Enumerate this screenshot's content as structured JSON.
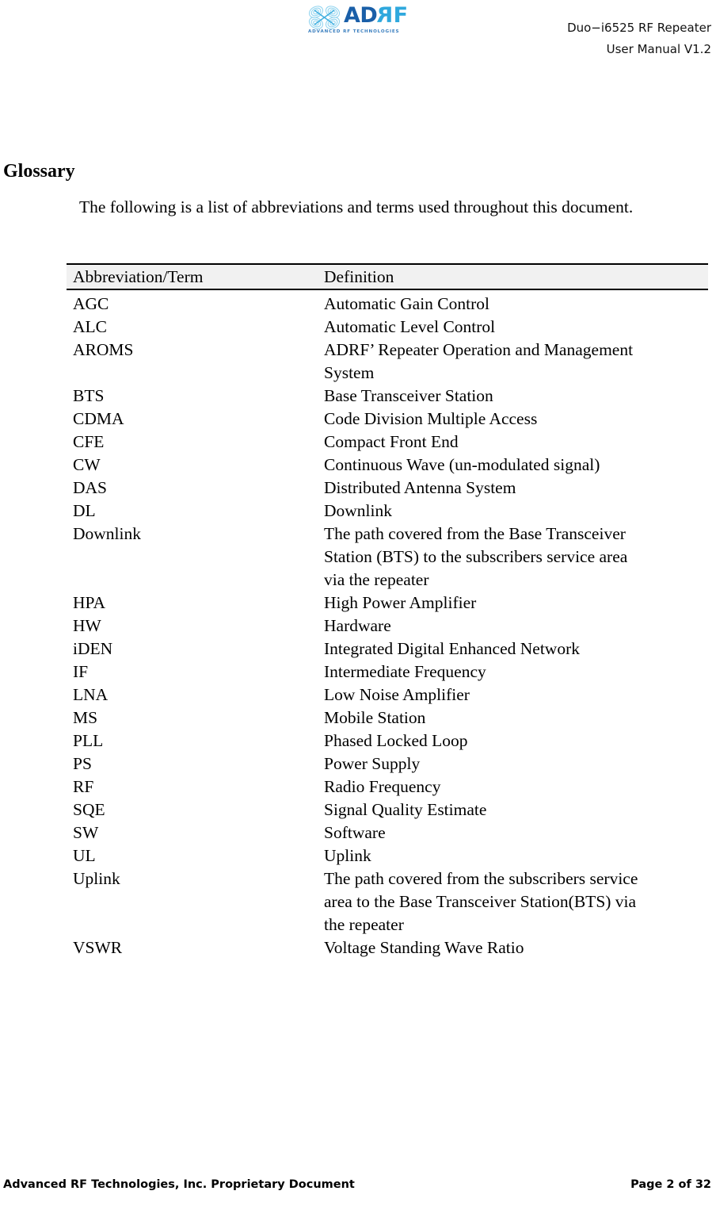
{
  "header": {
    "logo": {
      "mark_name": "adrf-butterfly-logo-icon",
      "word_ad": "AD",
      "word_r": "R",
      "word_f": "F",
      "tagline": "ADVANCED RF TECHNOLOGIES",
      "color_dark_blue": "#1a5fa8",
      "color_light_blue": "#2fa8dd"
    },
    "title_line1": "Duo−i6525 RF Repeater",
    "title_line2": "User Manual V1.2"
  },
  "body": {
    "heading": "Glossary",
    "intro_line1": "The following is a list of abbreviations and terms used throughout this",
    "intro_line2": "document."
  },
  "table": {
    "columns": [
      "Abbreviation/Term",
      "Definition"
    ],
    "header_background": "#f1f1f1",
    "rows": [
      {
        "term": "AGC",
        "definition_lines": [
          "Automatic Gain Control"
        ]
      },
      {
        "term": "ALC",
        "definition_lines": [
          "Automatic Level Control"
        ]
      },
      {
        "term": "AROMS",
        "definition_lines": [
          "ADRF’ Repeater Operation and Management",
          "System"
        ]
      },
      {
        "term": "BTS",
        "definition_lines": [
          "Base Transceiver Station"
        ]
      },
      {
        "term": "CDMA",
        "definition_lines": [
          "Code Division Multiple Access"
        ]
      },
      {
        "term": "CFE",
        "definition_lines": [
          "Compact Front End"
        ]
      },
      {
        "term": "CW",
        "definition_lines": [
          "Continuous Wave (un-modulated signal)"
        ]
      },
      {
        "term": "DAS",
        "definition_lines": [
          "Distributed Antenna System"
        ]
      },
      {
        "term": "DL",
        "definition_lines": [
          "Downlink"
        ]
      },
      {
        "term": "Downlink",
        "definition_lines": [
          "The path covered from the Base Transceiver",
          "Station (BTS) to the subscribers service area",
          "via the repeater"
        ]
      },
      {
        "term": "HPA",
        "definition_lines": [
          "High Power Amplifier"
        ]
      },
      {
        "term": "HW",
        "definition_lines": [
          "Hardware"
        ]
      },
      {
        "term": "iDEN",
        "definition_lines": [
          "Integrated Digital Enhanced Network"
        ]
      },
      {
        "term": "IF",
        "definition_lines": [
          "Intermediate Frequency"
        ]
      },
      {
        "term": "LNA",
        "definition_lines": [
          "Low Noise Amplifier"
        ]
      },
      {
        "term": "MS",
        "definition_lines": [
          "Mobile Station"
        ]
      },
      {
        "term": "PLL",
        "definition_lines": [
          "Phased Locked Loop"
        ]
      },
      {
        "term": "PS",
        "definition_lines": [
          "Power Supply"
        ]
      },
      {
        "term": "RF",
        "definition_lines": [
          "Radio Frequency"
        ]
      },
      {
        "term": "SQE",
        "definition_lines": [
          "Signal Quality Estimate"
        ]
      },
      {
        "term": "SW",
        "definition_lines": [
          "Software"
        ]
      },
      {
        "term": "UL",
        "definition_lines": [
          "Uplink"
        ]
      },
      {
        "term": "Uplink",
        "definition_lines": [
          "The path covered from the subscribers service",
          "area to the Base Transceiver Station(BTS) via",
          "the repeater"
        ]
      },
      {
        "term": "VSWR",
        "definition_lines": [
          "Voltage Standing Wave Ratio"
        ]
      }
    ]
  },
  "footer": {
    "left": "Advanced RF Technologies, Inc. Proprietary Document",
    "right": "Page 2 of 32"
  }
}
